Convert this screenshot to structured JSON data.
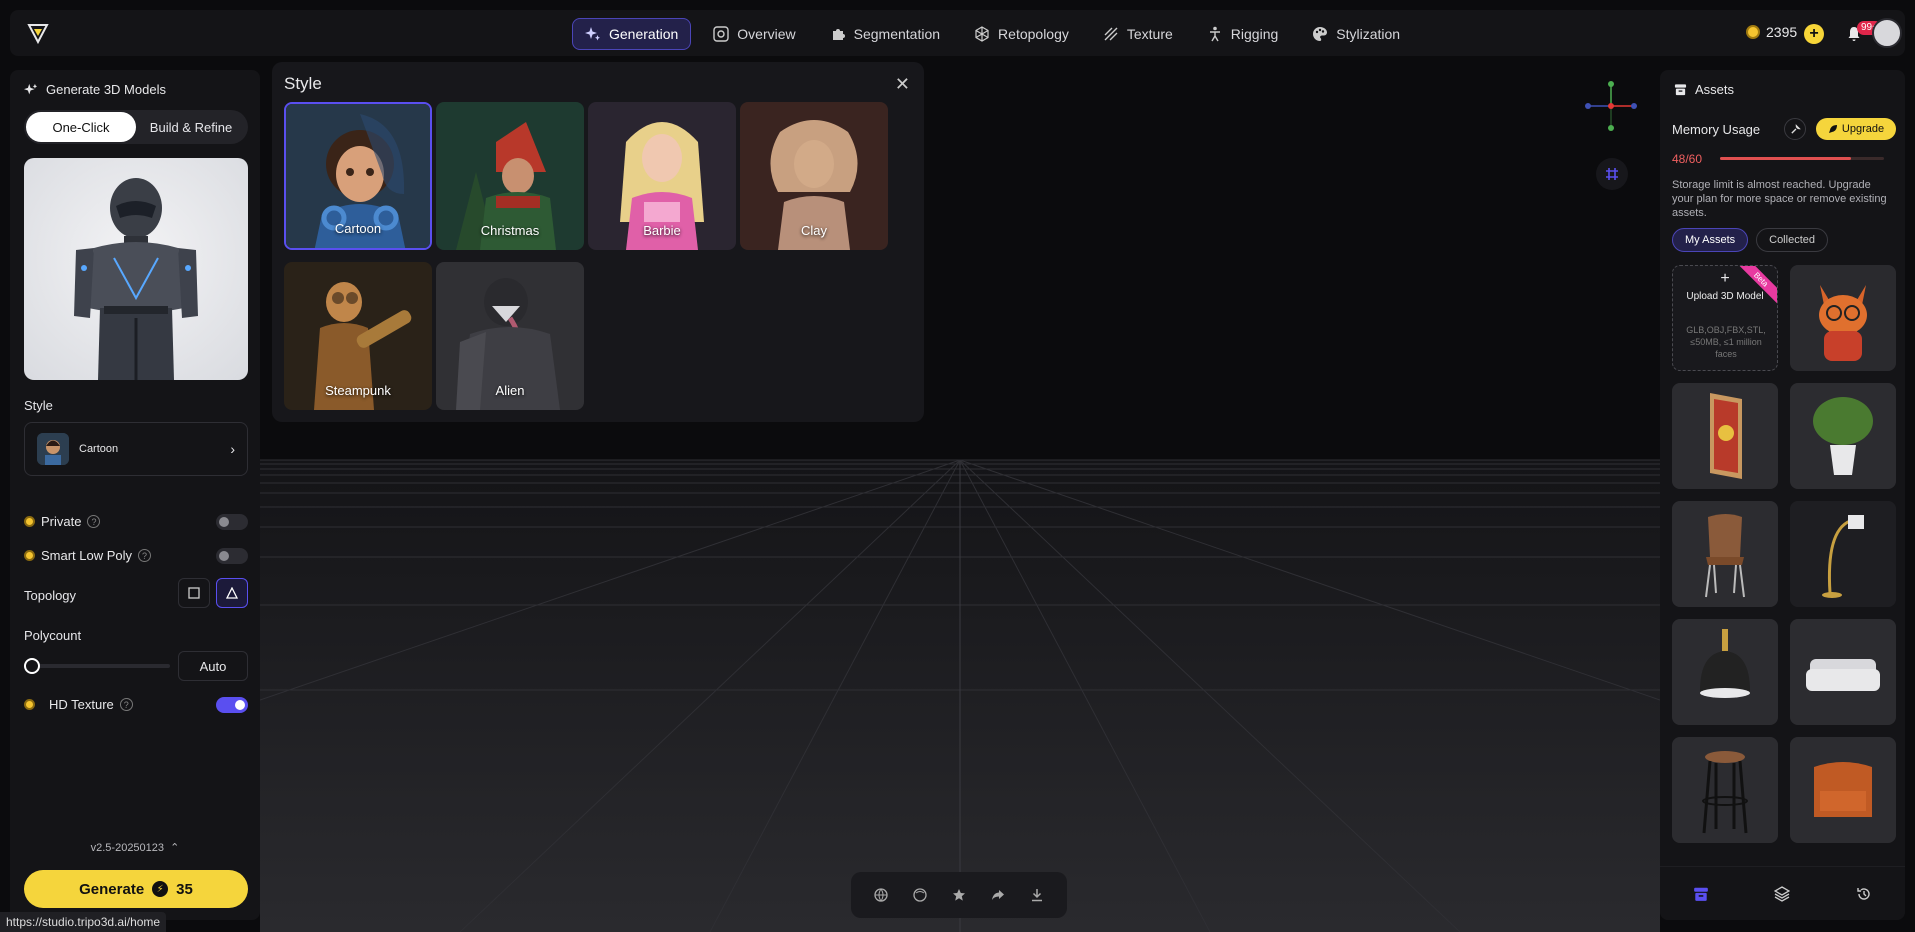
{
  "header": {
    "nav": [
      {
        "label": "Generation",
        "icon": "sparkles-icon",
        "active": true
      },
      {
        "label": "Overview",
        "icon": "scan-icon",
        "active": false
      },
      {
        "label": "Segmentation",
        "icon": "puzzle-icon",
        "active": false
      },
      {
        "label": "Retopology",
        "icon": "cube-mesh-icon",
        "active": false
      },
      {
        "label": "Texture",
        "icon": "texture-icon",
        "active": false
      },
      {
        "label": "Rigging",
        "icon": "figure-icon",
        "active": false
      },
      {
        "label": "Stylization",
        "icon": "palette-icon",
        "active": false
      }
    ],
    "credits": "2395",
    "notification_badge": "99+"
  },
  "left_panel": {
    "title": "Generate 3D Models",
    "modes": [
      "One-Click",
      "Build & Refine"
    ],
    "active_mode": "One-Click",
    "style_label": "Style",
    "style_selected": "Cartoon",
    "private_label": "Private",
    "private_on": false,
    "smart_low_poly_label": "Smart Low Poly",
    "smart_low_poly_on": false,
    "topology_label": "Topology",
    "topology_selected": "triangle",
    "polycount_label": "Polycount",
    "polycount_value": "Auto",
    "hd_texture_label": "HD Texture",
    "hd_texture_on": true,
    "version": "v2.5-20250123",
    "generate_label": "Generate",
    "generate_cost": "35"
  },
  "style_panel": {
    "title": "Style",
    "styles": [
      "Cartoon",
      "Christmas",
      "Barbie",
      "Clay",
      "Steampunk",
      "Alien"
    ],
    "selected": "Cartoon"
  },
  "right_panel": {
    "title": "Assets",
    "memory_label": "Memory Usage",
    "upgrade_label": "Upgrade",
    "memory_value": "48/60",
    "memory_fraction": 0.8,
    "memory_note": "Storage limit is almost reached. Upgrade your plan for more space or remove existing assets.",
    "tabs": [
      "My Assets",
      "Collected"
    ],
    "active_tab": "My Assets",
    "upload_title": "Upload 3D Model",
    "upload_formats": "GLB,OBJ,FBX,STL, ≤50MB, ≤1 million faces",
    "beta": "Beta"
  },
  "status_url": "https://studio.tripo3d.ai/home",
  "colors": {
    "accent": "#5a4ff0",
    "generate": "#f5d53c",
    "danger": "#e05050",
    "beta": "#e83aa0"
  }
}
